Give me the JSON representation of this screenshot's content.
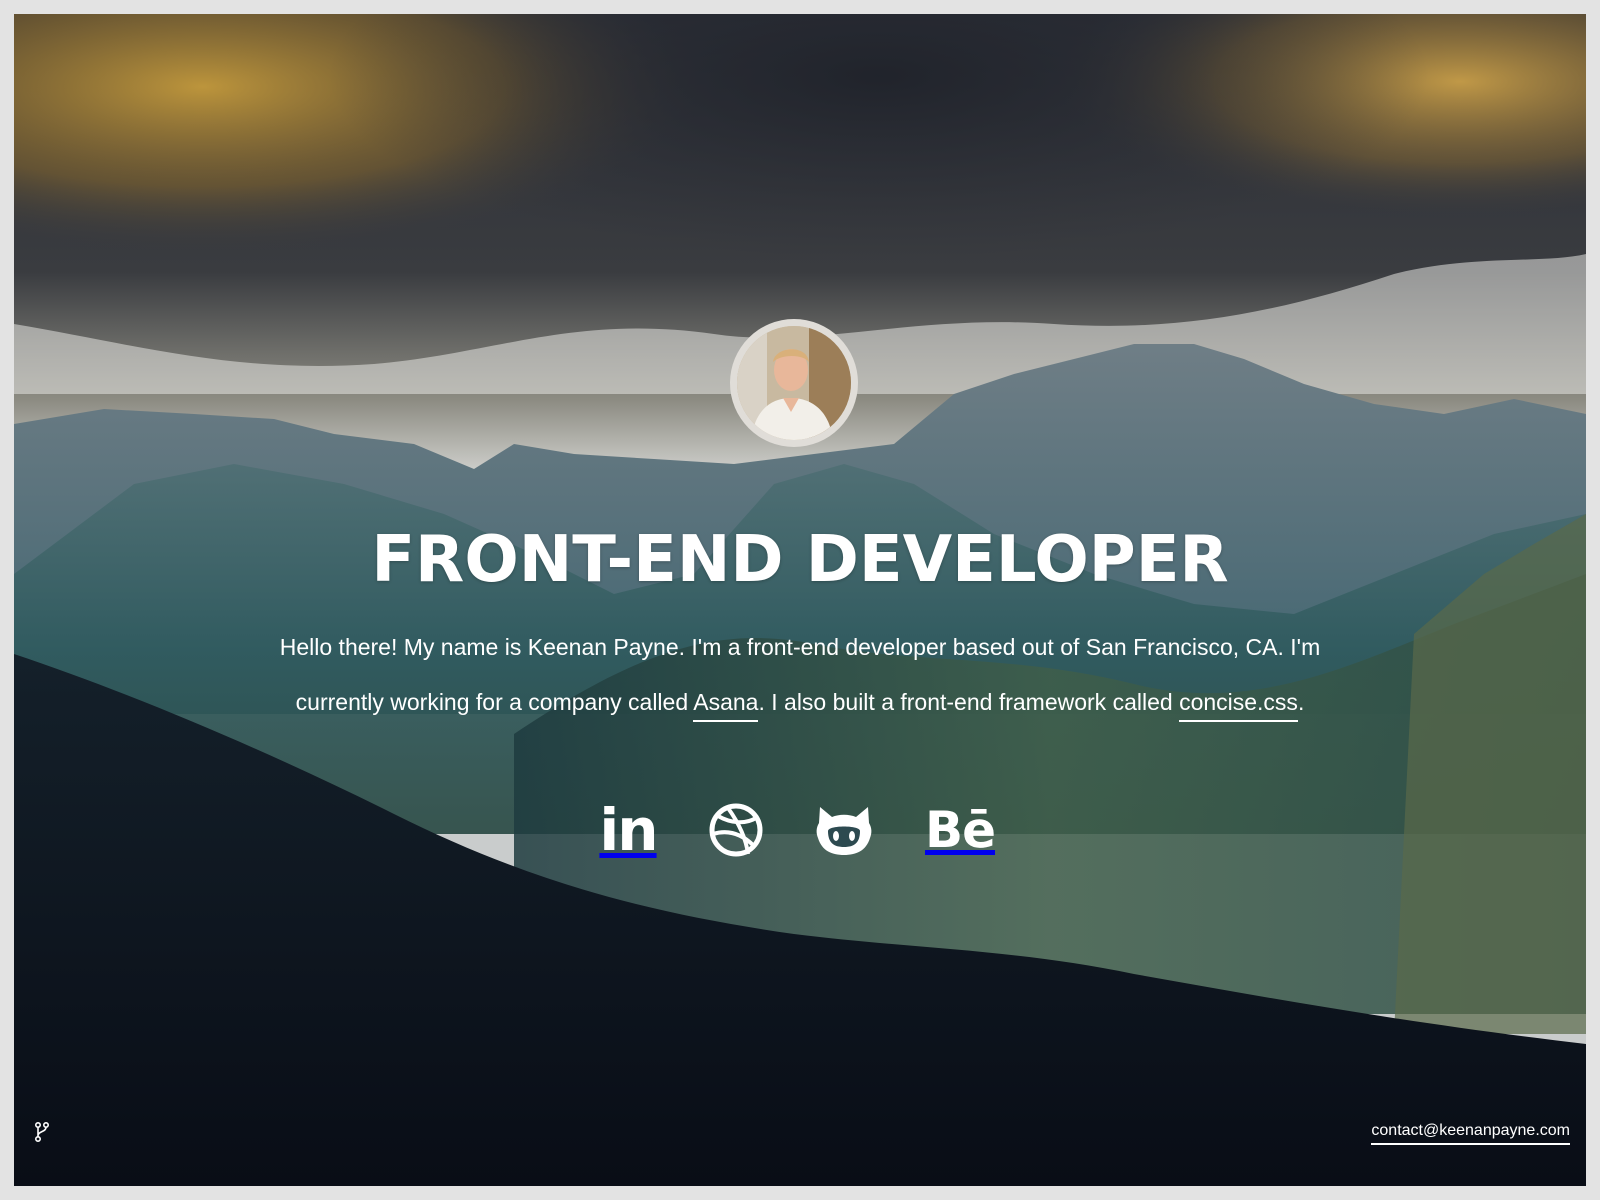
{
  "hero": {
    "title": "FRONT-END DEVELOPER",
    "bio_line1": "Hello there! My name is Keenan Payne. I'm a front-end developer based out of San Francisco, CA. I'm",
    "bio_line2_before": "currently working for a company called ",
    "bio_link_company": "Asana",
    "bio_line2_middle": ". I also built a front-end framework called ",
    "bio_link_framework": "concise.css",
    "bio_line2_end": "."
  },
  "socials": [
    {
      "icon": "linkedin-icon",
      "label": "in"
    },
    {
      "icon": "dribbble-icon"
    },
    {
      "icon": "github-icon"
    },
    {
      "icon": "behance-icon",
      "label": "Bē"
    }
  ],
  "footer": {
    "contact_email": "contact@keenanpayne.com",
    "fork_icon": "fork-icon"
  },
  "colors": {
    "text": "#ffffff",
    "page_border": "#e3e3e3"
  }
}
